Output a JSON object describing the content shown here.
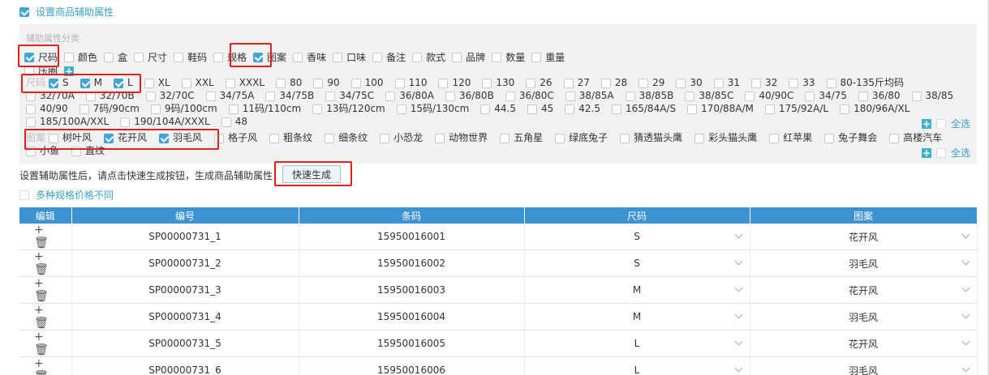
{
  "top_setting": {
    "label": "设置商品辅助属性",
    "checked": true
  },
  "panel": {
    "title": "辅助属性分类",
    "attributes": [
      {
        "label": "尺码",
        "checked": true
      },
      {
        "label": "颜色",
        "checked": false
      },
      {
        "label": "盒",
        "checked": false
      },
      {
        "label": "尺寸",
        "checked": false
      },
      {
        "label": "鞋码",
        "checked": false
      },
      {
        "label": "规格",
        "checked": false
      },
      {
        "label": "图案",
        "checked": true
      },
      {
        "label": "香味",
        "checked": false
      },
      {
        "label": "口味",
        "checked": false
      },
      {
        "label": "备注",
        "checked": false
      },
      {
        "label": "款式",
        "checked": false
      },
      {
        "label": "品牌",
        "checked": false
      },
      {
        "label": "数量",
        "checked": false
      },
      {
        "label": "重量",
        "checked": false
      },
      {
        "label": "压圈",
        "checked": false
      }
    ],
    "size_label": "尺码",
    "sizes": [
      {
        "label": "S",
        "checked": true
      },
      {
        "label": "M",
        "checked": true
      },
      {
        "label": "L",
        "checked": true
      },
      {
        "label": "XL",
        "checked": false
      },
      {
        "label": "XXL",
        "checked": false
      },
      {
        "label": "XXXL",
        "checked": false
      },
      {
        "label": "80",
        "checked": false
      },
      {
        "label": "90",
        "checked": false
      },
      {
        "label": "100",
        "checked": false
      },
      {
        "label": "110",
        "checked": false
      },
      {
        "label": "120",
        "checked": false
      },
      {
        "label": "130",
        "checked": false
      },
      {
        "label": "26",
        "checked": false
      },
      {
        "label": "27",
        "checked": false
      },
      {
        "label": "28",
        "checked": false
      },
      {
        "label": "29",
        "checked": false
      },
      {
        "label": "30",
        "checked": false
      },
      {
        "label": "31",
        "checked": false
      },
      {
        "label": "32",
        "checked": false
      },
      {
        "label": "33",
        "checked": false
      },
      {
        "label": "80-135斤均码",
        "checked": false
      },
      {
        "label": "32/70A",
        "checked": false
      },
      {
        "label": "32/70B",
        "checked": false
      },
      {
        "label": "32/70C",
        "checked": false
      },
      {
        "label": "34/75A",
        "checked": false
      },
      {
        "label": "34/75B",
        "checked": false
      },
      {
        "label": "34/75C",
        "checked": false
      },
      {
        "label": "36/80A",
        "checked": false
      },
      {
        "label": "36/80B",
        "checked": false
      },
      {
        "label": "36/80C",
        "checked": false
      },
      {
        "label": "38/85A",
        "checked": false
      },
      {
        "label": "38/85B",
        "checked": false
      },
      {
        "label": "38/85C",
        "checked": false
      },
      {
        "label": "40/90C",
        "checked": false
      },
      {
        "label": "34/75",
        "checked": false
      },
      {
        "label": "36/80",
        "checked": false
      },
      {
        "label": "38/85",
        "checked": false
      },
      {
        "label": "40/90",
        "checked": false
      },
      {
        "label": "7码/90cm",
        "checked": false
      },
      {
        "label": "9码/100cm",
        "checked": false
      },
      {
        "label": "11码/110cm",
        "checked": false
      },
      {
        "label": "13码/120cm",
        "checked": false
      },
      {
        "label": "15码/130cm",
        "checked": false
      },
      {
        "label": "44.5",
        "checked": false
      },
      {
        "label": "45",
        "checked": false
      },
      {
        "label": "42.5",
        "checked": false
      },
      {
        "label": "165/84A/S",
        "checked": false
      },
      {
        "label": "170/88A/M",
        "checked": false
      },
      {
        "label": "175/92A/L",
        "checked": false
      },
      {
        "label": "180/96A/XL",
        "checked": false
      },
      {
        "label": "185/100A/XXL",
        "checked": false
      },
      {
        "label": "190/104A/XXXL",
        "checked": false
      },
      {
        "label": "48",
        "checked": false
      }
    ],
    "select_all_label": "全选",
    "pattern_label": "图案",
    "patterns": [
      {
        "label": "树叶风",
        "checked": false
      },
      {
        "label": "花开风",
        "checked": true
      },
      {
        "label": "羽毛风",
        "checked": true
      },
      {
        "label": "格子风",
        "checked": false
      },
      {
        "label": "粗条纹",
        "checked": false
      },
      {
        "label": "细条纹",
        "checked": false
      },
      {
        "label": "小恐龙",
        "checked": false
      },
      {
        "label": "动物世界",
        "checked": false
      },
      {
        "label": "五角星",
        "checked": false
      },
      {
        "label": "绿底兔子",
        "checked": false
      },
      {
        "label": "猜透猫头鹰",
        "checked": false
      },
      {
        "label": "彩头猫头鹰",
        "checked": false
      },
      {
        "label": "红苹果",
        "checked": false
      },
      {
        "label": "兔子舞会",
        "checked": false
      },
      {
        "label": "高楼汽车",
        "checked": false
      },
      {
        "label": "小鱼",
        "checked": false
      },
      {
        "label": "直纹",
        "checked": false
      }
    ]
  },
  "hint": "设置辅助属性后，请点击快速生成按钮，生成商品辅助属性",
  "quick_button": "快速生成",
  "multi_price": {
    "label": "多种规格价格不同",
    "checked": false
  },
  "table": {
    "headers": [
      "编辑",
      "编号",
      "条码",
      "尺码",
      "图案"
    ],
    "rows": [
      {
        "code": "SP00000731_1",
        "barcode": "15950016001",
        "size": "S",
        "pattern": "花开风"
      },
      {
        "code": "SP00000731_2",
        "barcode": "15950016002",
        "size": "S",
        "pattern": "羽毛风"
      },
      {
        "code": "SP00000731_3",
        "barcode": "15950016003",
        "size": "M",
        "pattern": "花开风"
      },
      {
        "code": "SP00000731_4",
        "barcode": "15950016004",
        "size": "M",
        "pattern": "羽毛风"
      },
      {
        "code": "SP00000731_5",
        "barcode": "15950016005",
        "size": "L",
        "pattern": "花开风"
      },
      {
        "code": "SP00000731_6",
        "barcode": "15950016006",
        "size": "L",
        "pattern": "羽毛风"
      }
    ]
  },
  "colors": {
    "accent": "#41a5d8",
    "header": "#3c93d2",
    "highlight": "#e02020"
  }
}
